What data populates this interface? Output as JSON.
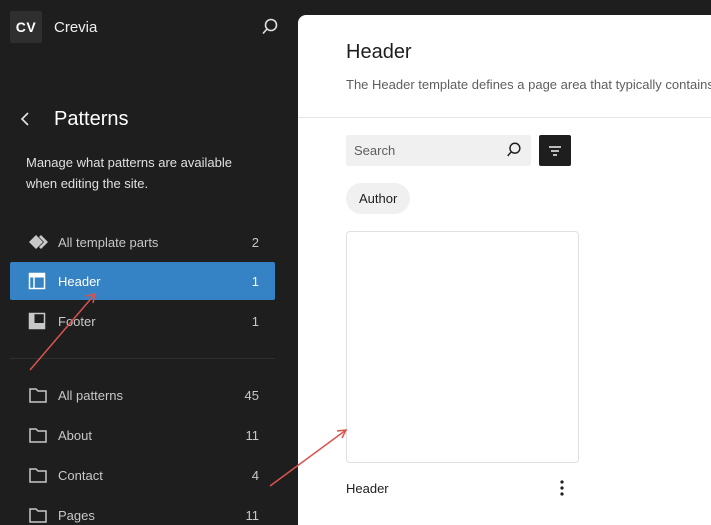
{
  "site": {
    "logo_text": "CV",
    "name": "Crevia"
  },
  "sidebar": {
    "title": "Patterns",
    "description": "Manage what patterns are available when editing the site.",
    "template_parts": [
      {
        "icon": "diamond-icon",
        "label": "All template parts",
        "count": "2",
        "active": false
      },
      {
        "icon": "header-layout-icon",
        "label": "Header",
        "count": "1",
        "active": true
      },
      {
        "icon": "footer-layout-icon",
        "label": "Footer",
        "count": "1",
        "active": false
      }
    ],
    "categories": [
      {
        "icon": "folder-icon",
        "label": "All patterns",
        "count": "45"
      },
      {
        "icon": "folder-icon",
        "label": "About",
        "count": "11"
      },
      {
        "icon": "folder-icon",
        "label": "Contact",
        "count": "4"
      },
      {
        "icon": "folder-icon",
        "label": "Pages",
        "count": "11"
      }
    ]
  },
  "main": {
    "title": "Header",
    "description": "The Header template defines a page area that typically contains a title, logo, and main navigation.",
    "search": {
      "placeholder": "Search",
      "value": ""
    },
    "author_filter": "Author",
    "cards": [
      {
        "title": "Header"
      }
    ]
  },
  "colors": {
    "sidebar_bg": "#1e1e1e",
    "accent": "#3582c4",
    "annotation": "#d9534f"
  }
}
